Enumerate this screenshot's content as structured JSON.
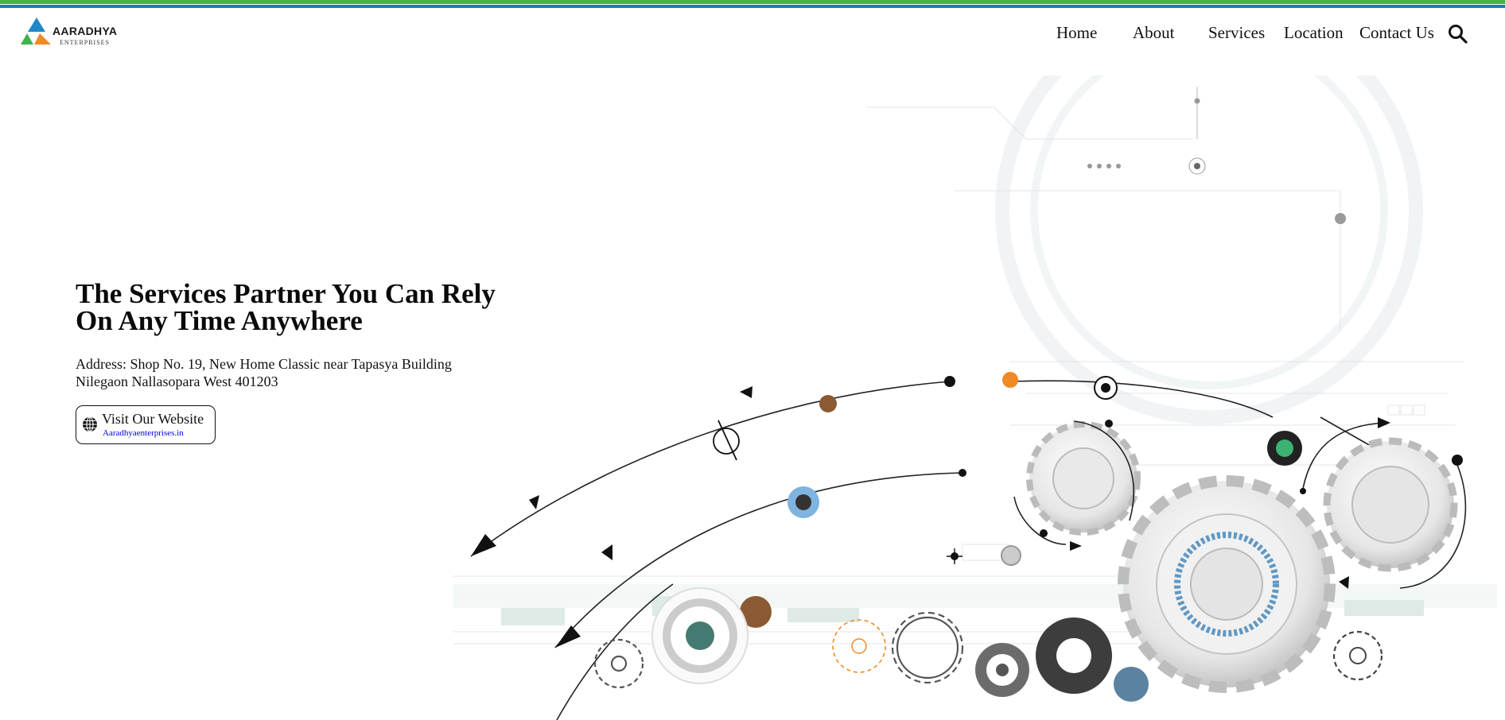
{
  "brand": {
    "name": "AARADHYA",
    "tagline": "ENTERPRISES",
    "colors": {
      "green": "#3fb44a",
      "blue": "#1c7fa6",
      "orange": "#f08a24",
      "navy": "#1e4fa0"
    }
  },
  "nav": {
    "items": [
      {
        "label": "Home"
      },
      {
        "label": "About"
      },
      {
        "label": "Services"
      },
      {
        "label": "Location"
      },
      {
        "label": "Contact Us"
      }
    ],
    "search_icon": "search-icon"
  },
  "hero": {
    "title": "The Services Partner You Can Rely On Any Time Anywhere",
    "address": "Address: Shop No. 19, New Home Classic near Tapasya Building Nilegaon Nallasopara West 401203",
    "cta": {
      "label": "Visit Our Website",
      "url_text": "Aaradhyaenterprises.in",
      "icon": "globe-icon"
    },
    "illustration": "gears-technology-illustration"
  }
}
